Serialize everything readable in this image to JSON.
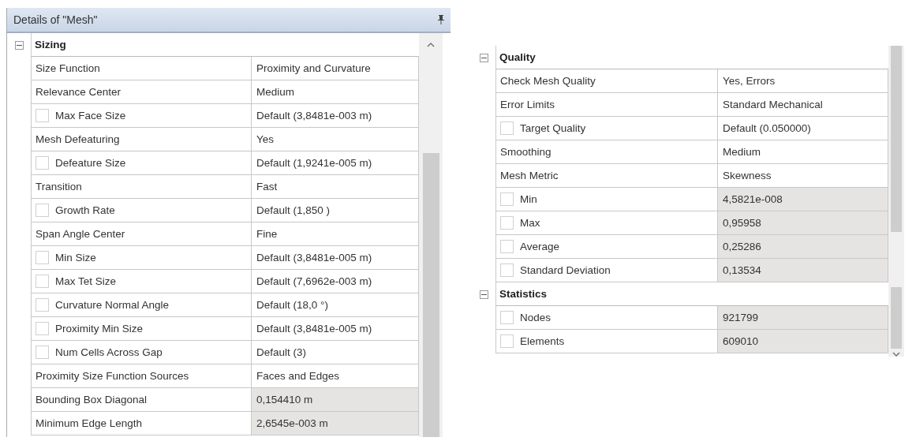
{
  "details_panel": {
    "title": "Details of \"Mesh\"",
    "sections": [
      {
        "title": "Sizing",
        "expanded": true,
        "rows": [
          {
            "kind": "plain",
            "label": "Size Function",
            "value": "Proximity and Curvature",
            "readonly": false
          },
          {
            "kind": "plain",
            "label": "Relevance Center",
            "value": "Medium",
            "readonly": false
          },
          {
            "kind": "checkbox",
            "checked": false,
            "label": "Max Face Size",
            "value": "Default (3,8481e-003 m)",
            "readonly": false
          },
          {
            "kind": "plain",
            "label": "Mesh Defeaturing",
            "value": "Yes",
            "readonly": false
          },
          {
            "kind": "checkbox",
            "checked": false,
            "label": "Defeature Size",
            "value": "Default (1,9241e-005 m)",
            "readonly": false
          },
          {
            "kind": "plain",
            "label": "Transition",
            "value": "Fast",
            "readonly": false
          },
          {
            "kind": "checkbox",
            "checked": false,
            "label": "Growth Rate",
            "value": "Default (1,850 )",
            "readonly": false
          },
          {
            "kind": "plain",
            "label": "Span Angle Center",
            "value": "Fine",
            "readonly": false
          },
          {
            "kind": "checkbox",
            "checked": false,
            "label": "Min Size",
            "value": "Default (3,8481e-005 m)",
            "readonly": false
          },
          {
            "kind": "checkbox",
            "checked": false,
            "label": "Max Tet Size",
            "value": "Default (7,6962e-003 m)",
            "readonly": false
          },
          {
            "kind": "checkbox",
            "checked": false,
            "label": "Curvature Normal Angle",
            "value": "Default (18,0 °)",
            "readonly": false
          },
          {
            "kind": "checkbox",
            "checked": false,
            "label": "Proximity Min Size",
            "value": "Default (3,8481e-005 m)",
            "readonly": false
          },
          {
            "kind": "checkbox",
            "checked": false,
            "label": "Num Cells Across Gap",
            "value": "Default (3)",
            "readonly": false
          },
          {
            "kind": "plain",
            "label": "Proximity Size Function Sources",
            "value": "Faces and Edges",
            "readonly": false
          },
          {
            "kind": "plain",
            "label": "Bounding Box Diagonal",
            "value": "0,154410 m",
            "readonly": true
          },
          {
            "kind": "plain",
            "label": "Minimum Edge Length",
            "value": "2,6545e-003 m",
            "readonly": true
          }
        ]
      }
    ]
  },
  "details_panel_scrolled": {
    "sections": [
      {
        "title": "Quality",
        "expanded": true,
        "rows": [
          {
            "kind": "plain",
            "label": "Check Mesh Quality",
            "value": "Yes, Errors",
            "readonly": false
          },
          {
            "kind": "plain",
            "label": "Error Limits",
            "value": "Standard Mechanical",
            "readonly": false
          },
          {
            "kind": "checkbox",
            "checked": false,
            "label": "Target Quality",
            "value": "Default (0.050000)",
            "readonly": false
          },
          {
            "kind": "plain",
            "label": "Smoothing",
            "value": "Medium",
            "readonly": false
          },
          {
            "kind": "plain",
            "label": "Mesh Metric",
            "value": "Skewness",
            "readonly": false
          },
          {
            "kind": "checkbox",
            "checked": false,
            "label": "Min",
            "value": "4,5821e-008",
            "readonly": true
          },
          {
            "kind": "checkbox",
            "checked": false,
            "label": "Max",
            "value": "0,95958",
            "readonly": true
          },
          {
            "kind": "checkbox",
            "checked": false,
            "label": "Average",
            "value": "0,25286",
            "readonly": true
          },
          {
            "kind": "checkbox",
            "checked": false,
            "label": "Standard Deviation",
            "value": "0,13534",
            "readonly": true
          }
        ]
      },
      {
        "title": "Statistics",
        "expanded": true,
        "rows": [
          {
            "kind": "checkbox",
            "checked": false,
            "label": "Nodes",
            "value": "921799",
            "readonly": true
          },
          {
            "kind": "checkbox",
            "checked": false,
            "label": "Elements",
            "value": "609010",
            "readonly": true
          }
        ]
      }
    ]
  }
}
